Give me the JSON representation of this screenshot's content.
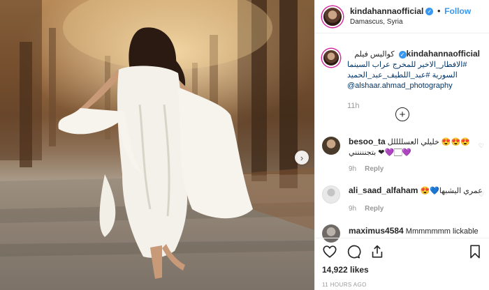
{
  "header": {
    "username": "kindahannaofficial",
    "separator": "•",
    "follow_label": "Follow",
    "location": "Damascus, Syria"
  },
  "caption": {
    "username": "kindahannaofficial",
    "line1": "كواليس فيلم",
    "line2": "#الافطار_الاخير للمخرج عراب السينما",
    "line3": "السورية #عبد_اللطيف_عبد_الحميد",
    "mention": "@alshaar.ahmad_photography",
    "time": "11h"
  },
  "load_more": {
    "icon": "plus-circle-icon",
    "glyph": "+"
  },
  "comments": [
    {
      "username": "besoo_ta",
      "text": "😍😍😍 خليلي العسللللل\n💜🏻💜❤ بتجننننني",
      "time": "9h",
      "reply_label": "Reply",
      "avatar_color": "#4a3a2c"
    },
    {
      "username": "ali_saad_alfaham",
      "text": "عمري اليشبها💙😍",
      "time": "9h",
      "reply_label": "Reply",
      "avatar_color": "#dcdcdc"
    },
    {
      "username": "maximus4584",
      "text": "Mmmmmmm lickable",
      "time": "",
      "reply_label": "",
      "avatar_color": "#8a8a8a"
    }
  ],
  "photo": {
    "next_icon": "chevron-right-icon",
    "next_glyph": "›"
  },
  "actions": {
    "likes": "14,922 likes",
    "posted": "11 HOURS AGO"
  },
  "colors": {
    "accent": "#3897f0",
    "verified": "#3897f0",
    "muted": "#999999"
  }
}
